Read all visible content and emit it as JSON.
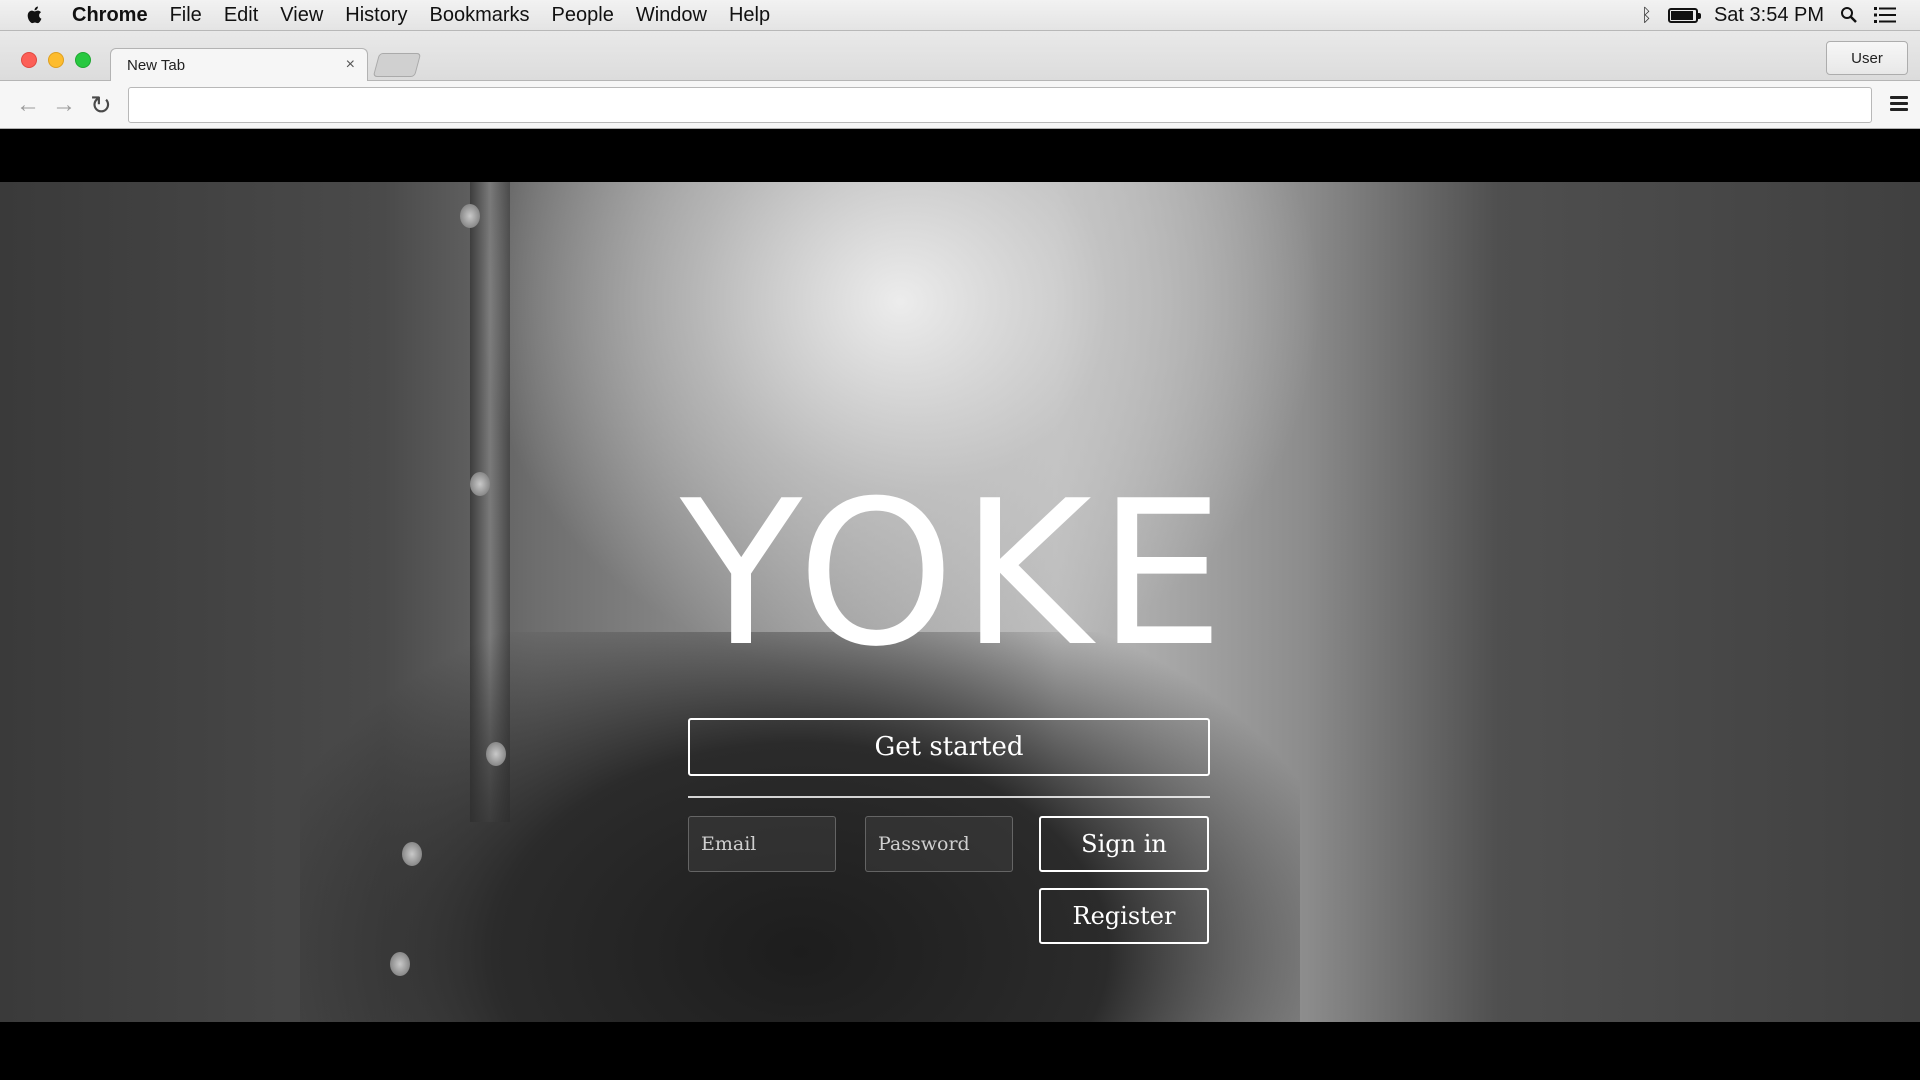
{
  "menubar": {
    "app_name": "Chrome",
    "items": [
      "File",
      "Edit",
      "View",
      "History",
      "Bookmarks",
      "People",
      "Window",
      "Help"
    ],
    "clock": "Sat 3:54 PM",
    "bluetooth_symbol": "ᛒ"
  },
  "browser": {
    "tab_title": "New Tab",
    "tab_close": "×",
    "user_button": "User",
    "address": "",
    "back_glyph": "←",
    "forward_glyph": "→",
    "reload_glyph": "↻"
  },
  "page": {
    "logo": "YOKE",
    "get_started": "Get started",
    "email_placeholder": "Email",
    "password_placeholder": "Password",
    "sign_in": "Sign in",
    "register": "Register"
  },
  "icons": {
    "apple": "apple-icon",
    "bluetooth": "bluetooth-icon",
    "battery": "battery-icon",
    "spotlight": "search-icon",
    "notifications": "list-icon",
    "chrome_menu": "hamburger-icon"
  }
}
